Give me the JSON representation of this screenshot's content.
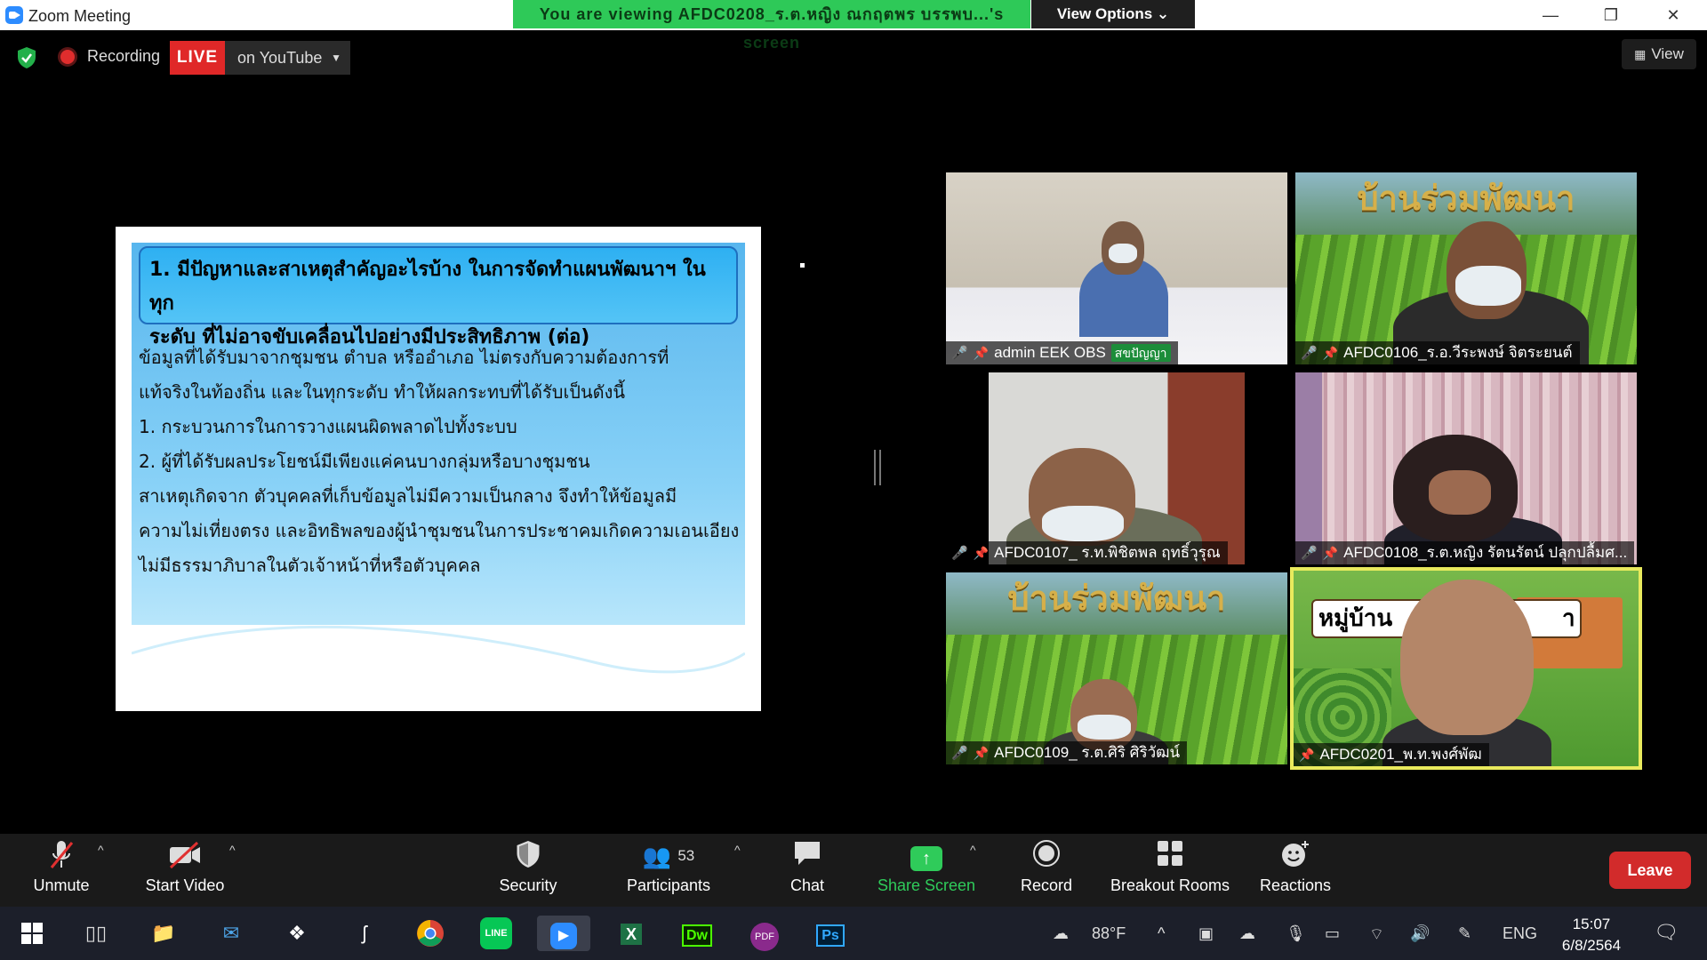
{
  "window": {
    "app_title": "Zoom Meeting",
    "viewing_banner": "You are viewing AFDC0208_ร.ต.หญิง ณกฤตพร บรรพบ...'s screen",
    "view_options": "View Options ⌄",
    "minimize": "—",
    "restore": "❐",
    "close": "✕"
  },
  "topbar": {
    "recording_label": "Recording",
    "live_label": "LIVE",
    "live_dest": "on YouTube",
    "view_label": "View"
  },
  "slide": {
    "title_lines": [
      "1. มีปัญหาและสาเหตุสำคัญอะไรบ้าง ในการจัดทำแผนพัฒนาฯ ในทุก",
      "ระดับ ที่ไม่อาจขับเคลื่อนไปอย่างมีประสิทธิภาพ (ต่อ)"
    ],
    "body_lines": [
      "            ข้อมูลที่ได้รับมาจากชุมชน ตำบล หรืออำเภอ ไม่ตรงกับความต้องการที่",
      "แท้จริงในท้องถิ่น และในทุกระดับ ทำให้ผลกระทบที่ได้รับเป็นดังนี้",
      "            1. กระบวนการในการวางแผนผิดพลาดไปทั้งระบบ",
      "            2. ผู้ที่ได้รับผลประโยชน์มีเพียงแค่คนบางกลุ่มหรือบางชุมชน",
      "            สาเหตุเกิดจาก ตัวบุคคลที่เก็บข้อมูลไม่มีความเป็นกลาง จึงทำให้ข้อมูลมี",
      "ความไม่เที่ยงตรง และอิทธิพลของผู้นำชุมชนในการประชาคมเกิดความเอนเอียง",
      "ไม่มีธรรมาภิบาลในตัวเจ้าหน้าที่หรือตัวบุคคล"
    ]
  },
  "participants_tiles": [
    {
      "name": "admin EEK OBS",
      "tag": "สขปัญญา",
      "muted": true
    },
    {
      "name": "AFDC0106_ร.อ.วีระพงษ์ จิตระยนต์",
      "banner": "บ้านร่วมพัฒนา",
      "muted": true
    },
    {
      "name": "AFDC0107_ ร.ท.พิชิตพล ฤทธิ์วุรุณ",
      "muted": true
    },
    {
      "name": "AFDC0108_ร.ต.หญิง รัตนรัตน์ ปลุกปลื้มศ...",
      "muted": true
    },
    {
      "name": "AFDC0109_ ร.ต.ศิริ ศิริวัฒน์",
      "banner": "บ้านร่วมพัฒนา",
      "muted": true
    },
    {
      "name": "AFDC0201_พ.ท.พงศ์พัฒ",
      "banner": "หมู่บ้าน",
      "banner_end": "า",
      "muted": false
    }
  ],
  "toolbar": {
    "unmute": "Unmute",
    "start_video": "Start Video",
    "security": "Security",
    "participants": "Participants",
    "participants_count": "53",
    "chat": "Chat",
    "share_screen": "Share Screen",
    "record": "Record",
    "breakout": "Breakout Rooms",
    "reactions": "Reactions",
    "leave": "Leave"
  },
  "taskbar": {
    "weather": "88°F",
    "lang": "ENG",
    "time": "15:07",
    "date": "6/8/2564",
    "apps": [
      "windows-start",
      "task-view",
      "file-explorer",
      "mail",
      "dropbox",
      "app-s",
      "chrome",
      "line",
      "zoom",
      "excel",
      "dreamweaver",
      "pdf",
      "photoshop"
    ]
  },
  "colors": {
    "live_red": "#e02828",
    "share_green": "#2fcb5a",
    "banner_green": "#2ec958",
    "active_speaker": "#e9ea5d",
    "leave_red": "#d22b2b"
  }
}
